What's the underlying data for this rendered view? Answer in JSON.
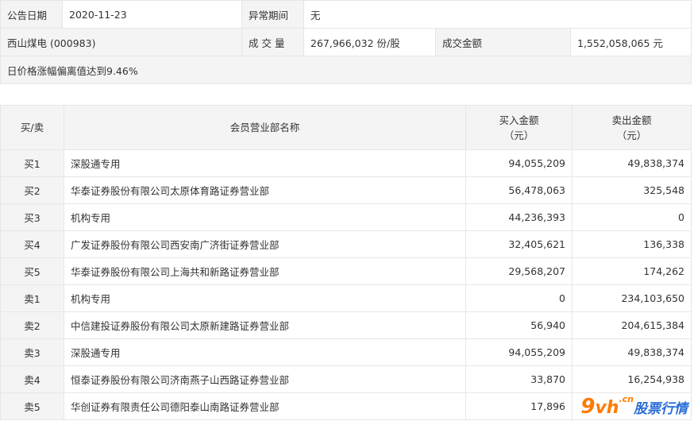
{
  "info": {
    "announce_date_label": "公告日期",
    "announce_date": "2020-11-23",
    "abnormal_period_label": "异常期间",
    "abnormal_period": "无",
    "stock": "西山煤电 (000983)",
    "volume_label": "成 交 量",
    "volume": "267,966,032 份/股",
    "amount_label": "成交金额",
    "amount": "1,552,058,065 元",
    "reason": "日价格涨幅偏离值达到9.46%"
  },
  "table": {
    "headers": {
      "side": "买/卖",
      "branch": "会员营业部名称",
      "buy_line1": "买入金额",
      "buy_line2": "（元）",
      "sell_line1": "卖出金额",
      "sell_line2": "（元）"
    },
    "rows": [
      {
        "side": "买1",
        "branch": "深股通专用",
        "buy": "94,055,209",
        "sell": "49,838,374"
      },
      {
        "side": "买2",
        "branch": "华泰证券股份有限公司太原体育路证券营业部",
        "buy": "56,478,063",
        "sell": "325,548"
      },
      {
        "side": "买3",
        "branch": "机构专用",
        "buy": "44,236,393",
        "sell": "0"
      },
      {
        "side": "买4",
        "branch": "广发证券股份有限公司西安南广济街证券营业部",
        "buy": "32,405,621",
        "sell": "136,338"
      },
      {
        "side": "买5",
        "branch": "华泰证券股份有限公司上海共和新路证券营业部",
        "buy": "29,568,207",
        "sell": "174,262"
      },
      {
        "side": "卖1",
        "branch": "机构专用",
        "buy": "0",
        "sell": "234,103,650"
      },
      {
        "side": "卖2",
        "branch": "中信建投证券股份有限公司太原新建路证券营业部",
        "buy": "56,940",
        "sell": "204,615,384"
      },
      {
        "side": "卖3",
        "branch": "深股通专用",
        "buy": "94,055,209",
        "sell": "49,838,374"
      },
      {
        "side": "卖4",
        "branch": "恒泰证券股份有限公司济南燕子山西路证券营业部",
        "buy": "33,870",
        "sell": "16,254,938"
      },
      {
        "side": "卖5",
        "branch": "华创证券有限责任公司德阳泰山南路证券营业部",
        "buy": "17,896",
        "sell": ""
      }
    ]
  },
  "watermark": {
    "nine": "9",
    "vh": "vh",
    "cn": ".cn",
    "text": "股票行情"
  }
}
